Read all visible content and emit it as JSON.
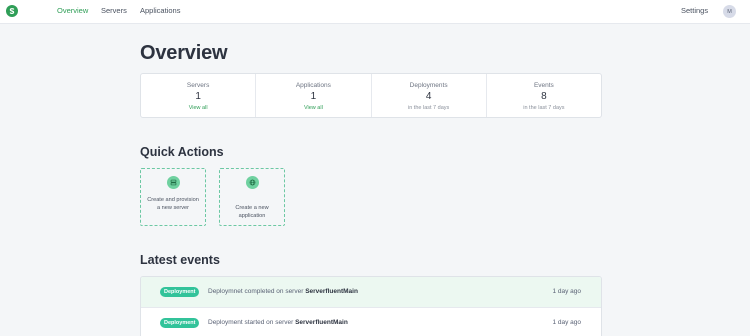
{
  "nav": {
    "links": [
      "Overview",
      "Servers",
      "Applications"
    ],
    "settings": "Settings",
    "avatar_initial": "M"
  },
  "page": {
    "title": "Overview"
  },
  "stats": [
    {
      "label": "Servers",
      "value": "1",
      "sub": "View all"
    },
    {
      "label": "Applications",
      "value": "1",
      "sub": "View all"
    },
    {
      "label": "Deployments",
      "value": "4",
      "sub": "in the last 7 days"
    },
    {
      "label": "Events",
      "value": "8",
      "sub": "in the last 7 days"
    }
  ],
  "quick_actions": {
    "title": "Quick Actions",
    "items": [
      {
        "label": "Create and provision a new server",
        "icon": "server-icon"
      },
      {
        "label": "Create a new application",
        "icon": "globe-icon"
      }
    ]
  },
  "events": {
    "title": "Latest events",
    "rows": [
      {
        "badge": "Deployment",
        "text": "Deploymnet completed on server ",
        "server": "ServerfluentMain",
        "time": "1 day ago"
      },
      {
        "badge": "Deployment",
        "text": "Deployment started on server ",
        "server": "ServerfluentMain",
        "time": "1 day ago"
      }
    ]
  },
  "colors": {
    "accent": "#2f9e57",
    "badge": "#32c39a",
    "highlight_row": "#ecf8f1"
  }
}
